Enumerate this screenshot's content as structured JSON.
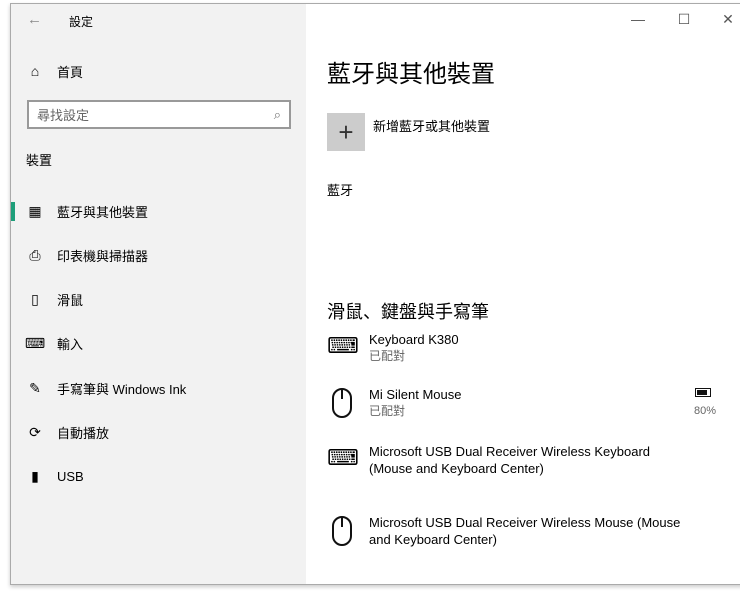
{
  "window": {
    "title": "設定",
    "back_icon": "back-arrow-icon",
    "minimize": "—",
    "maximize": "☐",
    "close": "✕"
  },
  "sidebar": {
    "home": "首頁",
    "search_placeholder": "尋找設定",
    "section": "裝置",
    "items": [
      {
        "label": "藍牙與其他裝置",
        "icon": "bluetooth-devices-icon"
      },
      {
        "label": "印表機與掃描器",
        "icon": "printer-icon"
      },
      {
        "label": "滑鼠",
        "icon": "mouse-icon"
      },
      {
        "label": "輸入",
        "icon": "keyboard-icon"
      },
      {
        "label": "手寫筆與 Windows Ink",
        "icon": "pen-icon"
      },
      {
        "label": "自動播放",
        "icon": "autoplay-icon"
      },
      {
        "label": "USB",
        "icon": "usb-icon"
      }
    ]
  },
  "main": {
    "title": "藍牙與其他裝置",
    "add_device": "新增藍牙或其他裝置",
    "bluetooth_label": "藍牙",
    "section_title": "滑鼠、鍵盤與手寫筆",
    "devices": [
      {
        "name": "Keyboard K380",
        "status": "已配對",
        "type": "keyboard"
      },
      {
        "name": "Mi Silent Mouse",
        "status": "已配對",
        "type": "mouse",
        "battery": "80%"
      },
      {
        "name": "Microsoft USB Dual Receiver Wireless Keyboard",
        "name2": "(Mouse and Keyboard Center)",
        "type": "keyboard"
      },
      {
        "name": "Microsoft USB Dual Receiver Wireless Mouse (Mouse",
        "name2": "and Keyboard Center)",
        "type": "mouse"
      }
    ]
  },
  "colors": {
    "accent": "#1e9e7a",
    "sidebar_bg": "#f2f2f2"
  }
}
